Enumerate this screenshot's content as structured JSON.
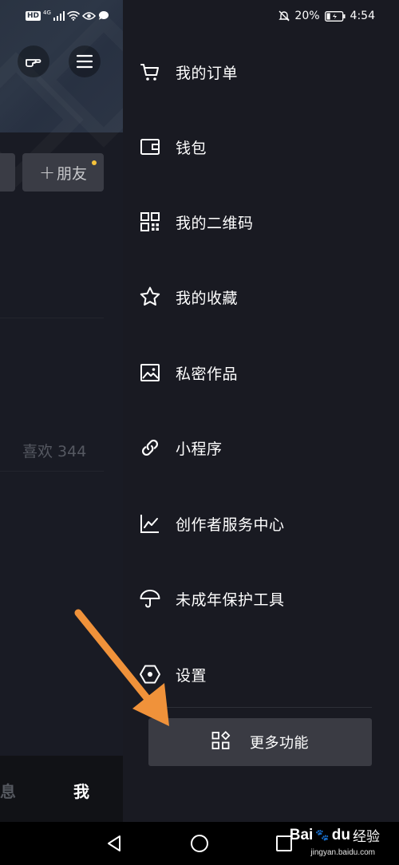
{
  "status_bar": {
    "left_badge": "HD",
    "network": "4G",
    "battery_percent": "20%",
    "time": "4:54"
  },
  "profile_background": {
    "add_friend_label": "朋友",
    "likes_label": "喜欢 344",
    "tab_messages": "息",
    "tab_me": "我"
  },
  "drawer": {
    "items": [
      {
        "label": "我的订单",
        "icon": "cart-icon"
      },
      {
        "label": "钱包",
        "icon": "wallet-icon"
      },
      {
        "label": "我的二维码",
        "icon": "qr-code-icon"
      },
      {
        "label": "我的收藏",
        "icon": "star-icon"
      },
      {
        "label": "私密作品",
        "icon": "image-icon"
      },
      {
        "label": "小程序",
        "icon": "link-icon"
      },
      {
        "label": "创作者服务中心",
        "icon": "chart-icon"
      },
      {
        "label": "未成年保护工具",
        "icon": "umbrella-icon"
      },
      {
        "label": "设置",
        "icon": "settings-hexagon-icon"
      }
    ],
    "more_button_label": "更多功能"
  },
  "watermark": {
    "brand": "Bai",
    "brand_suffix": "du",
    "product": "经验",
    "url": "jingyan.baidu.com"
  },
  "colors": {
    "drawer_bg": "#191a22",
    "annotation_arrow": "#f0923a",
    "new_dot": "#f5c33b"
  }
}
